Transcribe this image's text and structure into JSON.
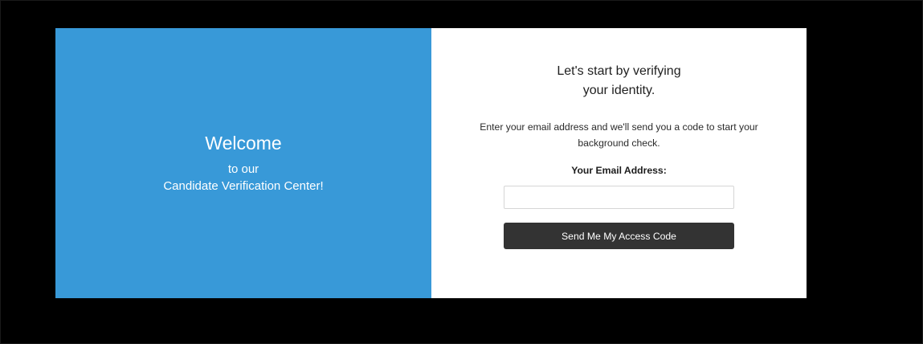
{
  "welcome_panel": {
    "title": "Welcome",
    "line1": "to our",
    "line2": "Candidate Verification Center!",
    "background_color": "#3899d8"
  },
  "verify_panel": {
    "heading_line1": "Let's start by verifying",
    "heading_line2": "your identity.",
    "description_line1": "Enter your email address and we'll send you a code to start your",
    "description_line2": "background check.",
    "email_label": "Your Email Address:",
    "email_value": "",
    "submit_label": "Send Me My Access Code",
    "button_color": "#333333"
  }
}
